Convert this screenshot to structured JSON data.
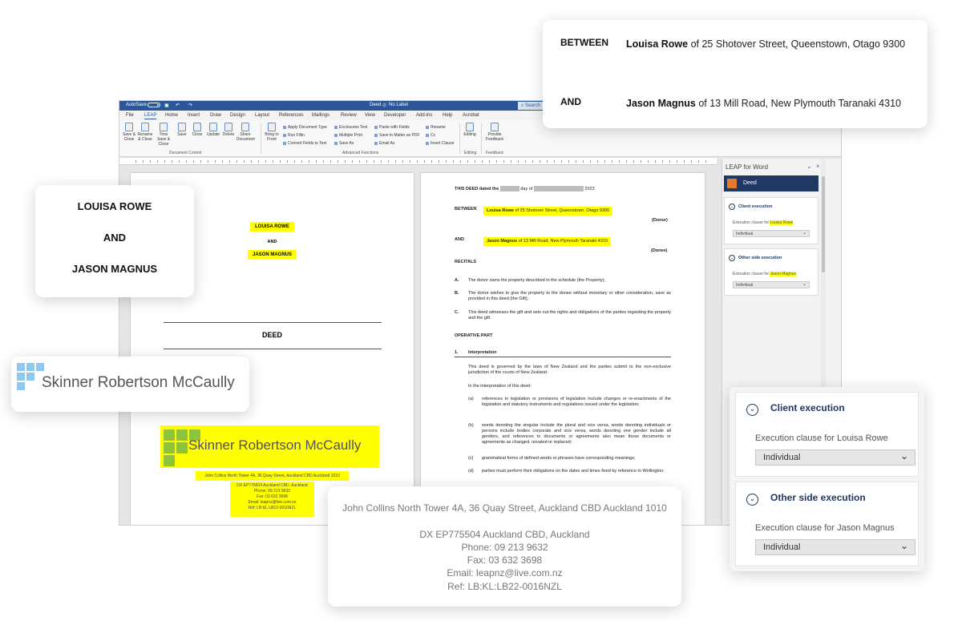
{
  "word": {
    "titlebar": {
      "autosave": "AutoSave",
      "autosave_state": "Off",
      "doc_title": "Deed",
      "label": "No Label",
      "search": "Search"
    },
    "menu": [
      "File",
      "LEAP",
      "Home",
      "Insert",
      "Draw",
      "Design",
      "Layout",
      "References",
      "Mailings",
      "Review",
      "View",
      "Developer",
      "Add-ins",
      "Help",
      "Acrobat"
    ],
    "ribbon": {
      "buttons": [
        "Save & Close",
        "Rename & Close",
        "Time Save & Close",
        "Save",
        "Close",
        "Update",
        "Delete",
        "Share Document",
        "Bring to Front"
      ],
      "items": [
        "Apply Document Type",
        "Run Fillin",
        "Convert Fields to Text",
        "Enclosures Text",
        "Multiple Print",
        "Save As",
        "Paste with Fields",
        "Save to Matter as PDF",
        "Email As",
        "Rename",
        "Cc",
        "Insert Clause"
      ],
      "editing": "Editing",
      "feedback": "Provide Feedback",
      "groups": [
        "Document Control",
        "Advanced Functions",
        "Editing",
        "Feedback"
      ]
    },
    "page1": {
      "party1": "LOUISA ROWE",
      "and": "AND",
      "party2": "JASON MAGNUS",
      "title": "DEED",
      "logo_text": "Skinner Robertson McCaully",
      "address": "John Collins North Tower 4A, 36 Quay Street, Auckland CBD Auckland 1010",
      "contact": [
        "DX EP775504 Auckland CBD, Auckland",
        "Phone: 09 213 9632",
        "Fax: 03 632 3698",
        "Email: leapnz@live.com.nz",
        "Ref: LB:KL:LB22-0016NZL"
      ]
    },
    "page2": {
      "dated_a": "THIS DEED dated the",
      "dated_b": "day of",
      "dated_c": "2023",
      "between": "BETWEEN",
      "donor_name": "Louisa Rowe",
      "donor_addr": "of 25 Shotover Street, Queenstown, Otago 9300",
      "donor_role": "(Donor)",
      "and": "AND",
      "donee_name": "Jason Magnus",
      "donee_addr": "of 13 Mill Road, New Plymouth Taranaki 4310",
      "donee_role": "(Donee)",
      "recitals": "RECITALS",
      "recital_items": [
        {
          "k": "A.",
          "t": "The donor owns the property described in the schedule (the Property);"
        },
        {
          "k": "B.",
          "t": "The donor wishes to give the property to the donee without monetary or other consideration, save as provided in this deed (the Gift);"
        },
        {
          "k": "C.",
          "t": "This deed witnesses the gift and sets out the rights and obligations of the parties regarding the property and the gift."
        }
      ],
      "operative": "OPERATIVE PART",
      "sec1_num": "1.",
      "sec1_title": "Interpretation",
      "sec1_para": "This deed is governed by the laws of New Zealand and the parties submit to the non-exclusive jurisdiction of the courts of New Zealand.",
      "sec1_intro": "In the interpretation of this deed:",
      "sec1_items": [
        {
          "k": "(a)",
          "t": "references to legislation or provisions of legislation include changes or re-enactments of the legislation and statutory instruments and regulations issued under the legislation;"
        },
        {
          "k": "(b)",
          "t": "words denoting the singular include the plural and vice versa, words denoting individuals or persons include bodies corporate and vice versa, words denoting one gender include all genders, and references to documents or agreements also mean those documents or agreements as changed, novated or replaced;"
        },
        {
          "k": "(c)",
          "t": "grammatical forms of defined words or phrases have corresponding meanings;"
        },
        {
          "k": "(d)",
          "t": "parties must perform their obligations on the dates and times fixed by reference to Wellington;"
        }
      ]
    },
    "pane": {
      "title": "LEAP for Word",
      "header": "Deed",
      "client_title": "Client execution",
      "client_label": "Execution clause for",
      "client_name": "Louisa Rowe",
      "client_value": "Individual",
      "other_title": "Other side execution",
      "other_label": "Execution clause for",
      "other_name": "Jason Magnus",
      "other_value": "Individual"
    }
  },
  "cards": {
    "between": {
      "between_label": "BETWEEN",
      "between_name": "Louisa Rowe",
      "between_addr": "of 25 Shotover Street, Queenstown, Otago 9300",
      "and_label": "AND",
      "and_name": "Jason Magnus",
      "and_addr": "of 13 Mill Road, New Plymouth Taranaki 4310"
    },
    "parties": {
      "party1": "LOUISA ROWE",
      "and": "AND",
      "party2": "JASON MAGNUS"
    },
    "logo": {
      "text": "Skinner Robertson McCaully"
    },
    "address": {
      "line1": "John Collins North Tower 4A, 36 Quay Street, Auckland CBD Auckland 1010",
      "line2": "DX EP775504 Auckland CBD, Auckland",
      "line3": "Phone: 09 213 9632",
      "line4": "Fax: 03 632 3698",
      "line5": "Email: leapnz@live.com.nz",
      "line6": "Ref: LB:KL:LB22-0016NZL"
    },
    "execution": {
      "client_title": "Client execution",
      "client_label": "Execution clause for Louisa Rowe",
      "client_value": "Individual",
      "other_title": "Other side execution",
      "other_label": "Execution clause for Jason Magnus",
      "other_value": "Individual"
    }
  },
  "colors": {
    "word_blue": "#2b579a",
    "highlight": "#ffff00",
    "navy": "#1f3864",
    "logo_blue": "#8ec9f0",
    "logo_green": "#8fc33c"
  }
}
